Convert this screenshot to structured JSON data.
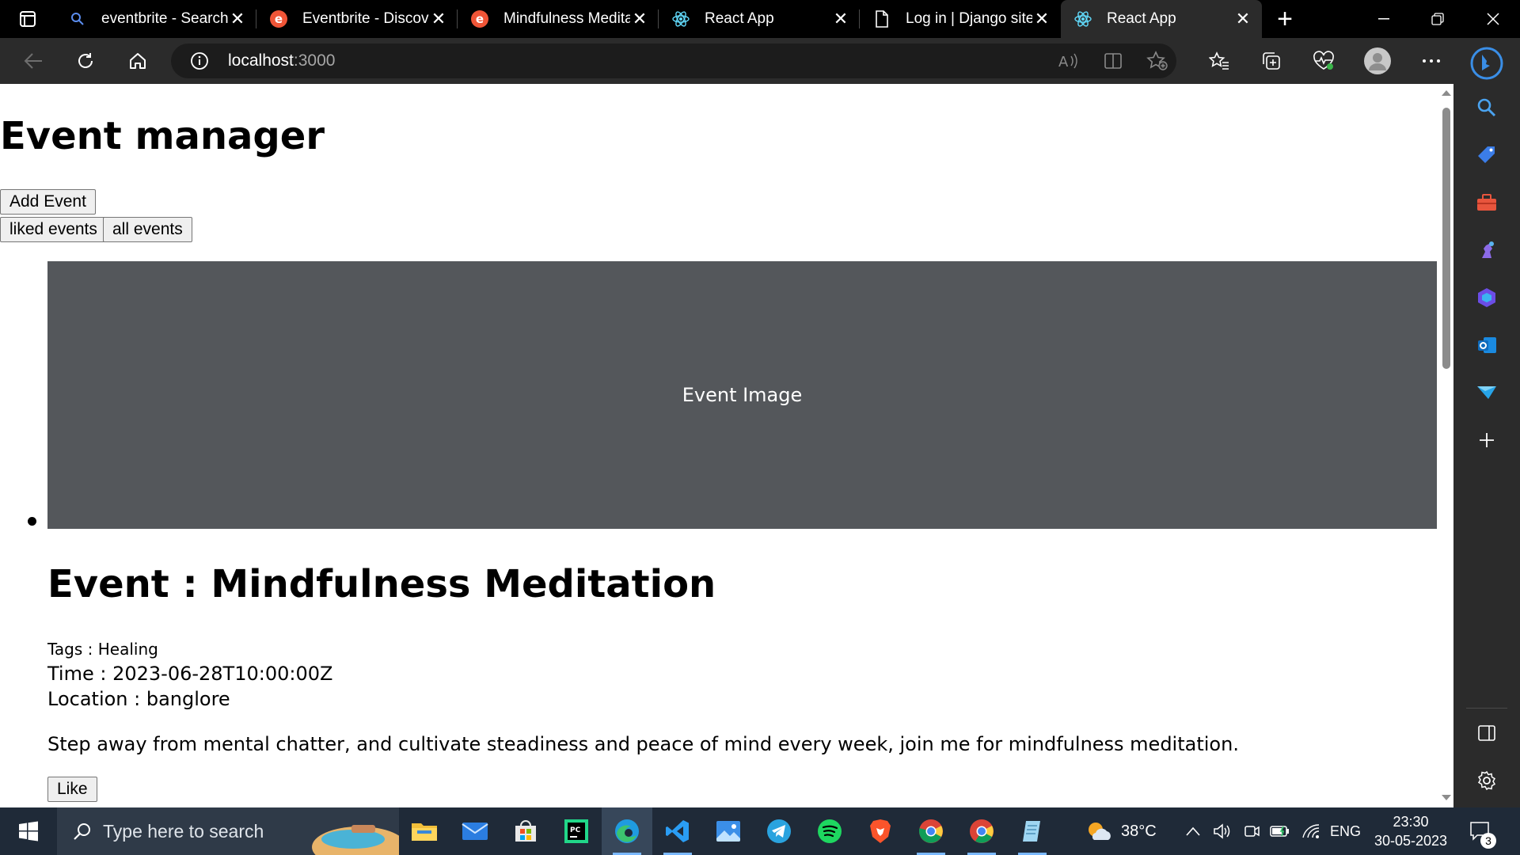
{
  "browser": {
    "tabs": [
      {
        "title": "eventbrite - Search",
        "icon": "search-icon",
        "active": false
      },
      {
        "title": "Eventbrite - Discove",
        "icon": "eventbrite-icon",
        "active": false
      },
      {
        "title": "Mindfulness Medita",
        "icon": "eventbrite-icon",
        "active": false
      },
      {
        "title": "React App",
        "icon": "react-icon",
        "active": false
      },
      {
        "title": "Log in | Django site",
        "icon": "page-icon",
        "active": false
      },
      {
        "title": "React App",
        "icon": "react-icon",
        "active": true
      }
    ],
    "address": {
      "host": "localhost",
      "port": ":3000"
    }
  },
  "page": {
    "title": "Event manager",
    "add_event_label": "Add Event",
    "liked_events_label": "liked events",
    "all_events_label": "all events",
    "event": {
      "image_alt": "Event Image",
      "title": "Event : Mindfulness Meditation",
      "tags": "Tags : Healing",
      "time": "Time : 2023-06-28T10:00:00Z",
      "location": "Location : banglore",
      "description": "Step away from mental chatter, and cultivate steadiness and peace of mind every week, join me for mindfulness meditation.",
      "like_label": "Like"
    }
  },
  "taskbar": {
    "search_placeholder": "Type here to search",
    "weather": "38°C",
    "language": "ENG",
    "time": "23:30",
    "date": "30-05-2023",
    "notifications": "3"
  },
  "colors": {
    "tab_bar": "#000000",
    "toolbar": "#2b2b2b",
    "event_image_bg": "#54575b",
    "taskbar": "#1f2a38"
  }
}
